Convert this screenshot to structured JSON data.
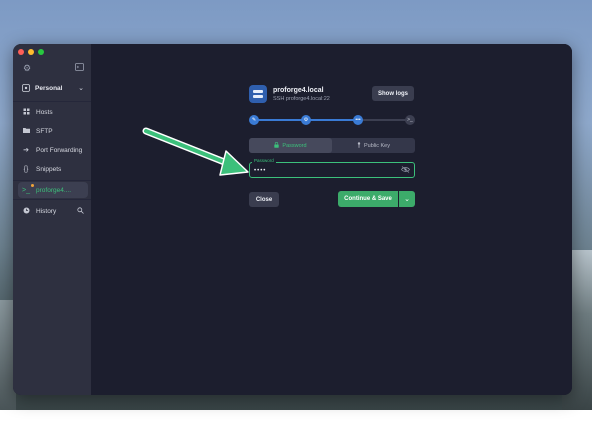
{
  "sidebar": {
    "vault_label": "Personal",
    "items": [
      {
        "label": "Hosts",
        "icon": "hosts-icon"
      },
      {
        "label": "SFTP",
        "icon": "folder-icon"
      },
      {
        "label": "Port Forwarding",
        "icon": "arrow-right-icon"
      },
      {
        "label": "Snippets",
        "icon": "braces-icon"
      }
    ],
    "active_session": "proforge4....",
    "history_label": "History"
  },
  "host": {
    "name": "proforge4.local",
    "subtitle": "SSH proforge4.local:22"
  },
  "buttons": {
    "show_logs": "Show logs",
    "close": "Close",
    "continue_save": "Continue & Save"
  },
  "auth_tabs": {
    "password": "Password",
    "public_key": "Public Key"
  },
  "password_field": {
    "label": "Password",
    "value": "••••"
  },
  "colors": {
    "accent_green": "#3cc07b",
    "progress_blue": "#3a7bd5",
    "window_bg": "#1c1e2e",
    "sidebar_bg": "#2e3040"
  }
}
